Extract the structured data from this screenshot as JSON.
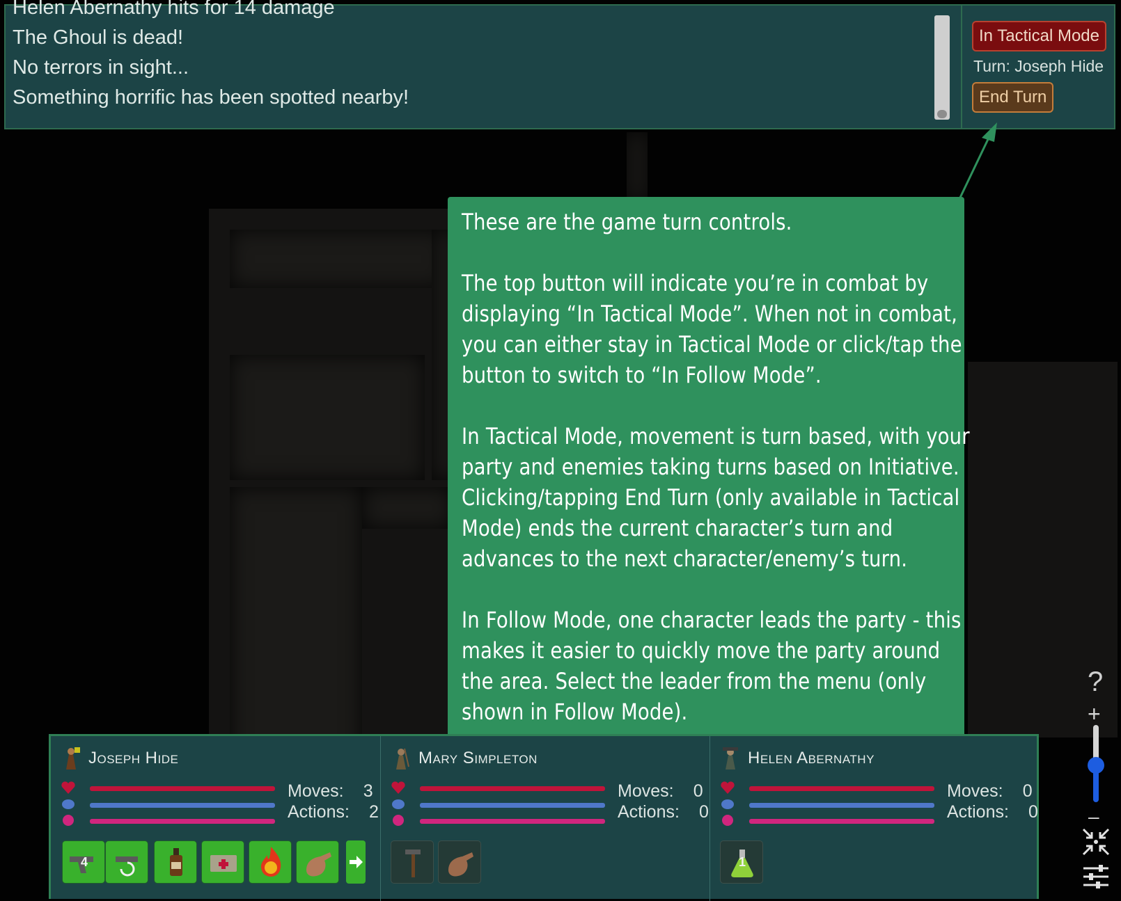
{
  "log": {
    "lines": [
      "Helen Abernathy hits for 14 damage",
      "The Ghoul is dead!",
      "No terrors in sight...",
      "Something horrific has been spotted nearby!"
    ]
  },
  "turn_controls": {
    "mode_label": "In Tactical Mode",
    "turn_label": "Turn: Joseph Hide",
    "end_turn_label": "End Turn"
  },
  "tooltip": {
    "paragraphs": [
      "These are the game turn controls.",
      "The top button will indicate you’re in combat by displaying “In Tactical Mode”. When not in combat, you can either stay in Tactical Mode or click/tap the button to switch to “In Follow Mode”.",
      "In Tactical Mode, movement is turn based, with your party and enemies taking turns based on Initiative. Clicking/tapping End Turn (only available in Tactical Mode) ends the current character’s turn and advances to the next character/enemy’s turn.",
      "In Follow Mode, one character leads the party - this makes it easier to quickly move the party around the area. Select the leader from the menu (only shown in Follow Mode)."
    ]
  },
  "side_controls": {
    "help": "?",
    "zoom_in": "+",
    "zoom_out": "–",
    "zoom_level": 0.45
  },
  "party": {
    "moves_label": "Moves:",
    "actions_label": "Actions:",
    "characters": [
      {
        "name": "Joseph Hide",
        "moves": "3",
        "actions": "2",
        "items": [
          {
            "icon": "revolver-icon",
            "badge": "4",
            "enabled": true
          },
          {
            "icon": "reload-icon",
            "badge": "",
            "enabled": true
          },
          {
            "icon": "bottle-icon",
            "badge": "",
            "enabled": true
          },
          {
            "icon": "first-aid-icon",
            "badge": "",
            "enabled": true
          },
          {
            "icon": "fire-ability-icon",
            "badge": "",
            "enabled": true
          },
          {
            "icon": "hand-icon",
            "badge": "",
            "enabled": true
          }
        ]
      },
      {
        "name": "Mary Simpleton",
        "moves": "0",
        "actions": "0",
        "items": [
          {
            "icon": "hammer-icon",
            "badge": "",
            "enabled": false
          },
          {
            "icon": "hand-icon",
            "badge": "",
            "enabled": false
          }
        ]
      },
      {
        "name": "Helen Abernathy",
        "moves": "0",
        "actions": "0",
        "items": [
          {
            "icon": "potion-flask-icon",
            "badge": "1",
            "enabled": false
          }
        ]
      }
    ]
  },
  "colors": {
    "panel_bg": "#1c4446",
    "tooltip_bg": "#2f915d",
    "tactical_mode": "#7a0d0f",
    "end_turn": "#5a3a1c",
    "health": "#c0143a",
    "sanity": "#4f78c9",
    "stamina": "#d0267e",
    "item_active": "#39b12c"
  }
}
